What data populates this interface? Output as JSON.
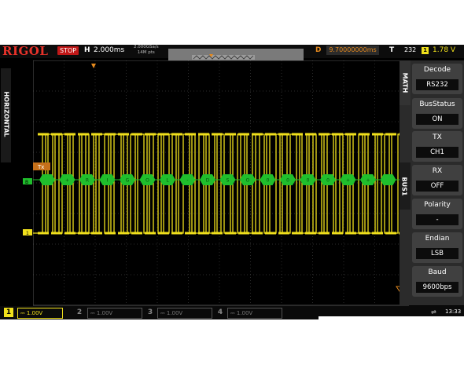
{
  "topbar": {
    "brand": "RIGOL",
    "run_state": "STOP",
    "timebase_label": "H",
    "timebase": "2.000ms",
    "sample_rate": "2.000GSa/s",
    "memory_depth": "14M pts",
    "delay_label": "D",
    "delay": "9.70000000ms",
    "trigger_label": "T",
    "trigger_count": "232",
    "trigger_source": "1",
    "trigger_level": "1.78 V"
  },
  "left_panel": {
    "label": "HORIZONTAL"
  },
  "menu": {
    "tabs": [
      "MATH",
      "BUS1"
    ],
    "items": [
      {
        "label": "Decode",
        "value": "RS232"
      },
      {
        "label": "BusStatus",
        "value": "ON"
      },
      {
        "label": "TX",
        "value": "CH1"
      },
      {
        "label": "RX",
        "value": "OFF"
      },
      {
        "label": "Polarity",
        "value": "-"
      },
      {
        "label": "Endian",
        "value": "LSB"
      },
      {
        "label": "Baud",
        "value": "9600bps"
      }
    ]
  },
  "waveform": {
    "bus_label": "Tx",
    "decoded_bytes": [
      "",
      "+",
      "R",
      "I",
      "G",
      "O",
      "L",
      "-",
      "D",
      "S",
      "O",
      "0",
      "0",
      "0",
      "0",
      "+",
      "+",
      ""
    ]
  },
  "channels": [
    {
      "num": "1",
      "scale": "1.00V",
      "active": true
    },
    {
      "num": "2",
      "scale": "1.00V",
      "active": false
    },
    {
      "num": "3",
      "scale": "1.00V",
      "active": false
    },
    {
      "num": "4",
      "scale": "1.00V",
      "active": false
    }
  ],
  "status": {
    "time": "13:33"
  },
  "colors": {
    "ch1": "#f0e01c",
    "bus": "#1fbf2c",
    "trigger": "#e68a1e",
    "brand": "#e8322a"
  }
}
